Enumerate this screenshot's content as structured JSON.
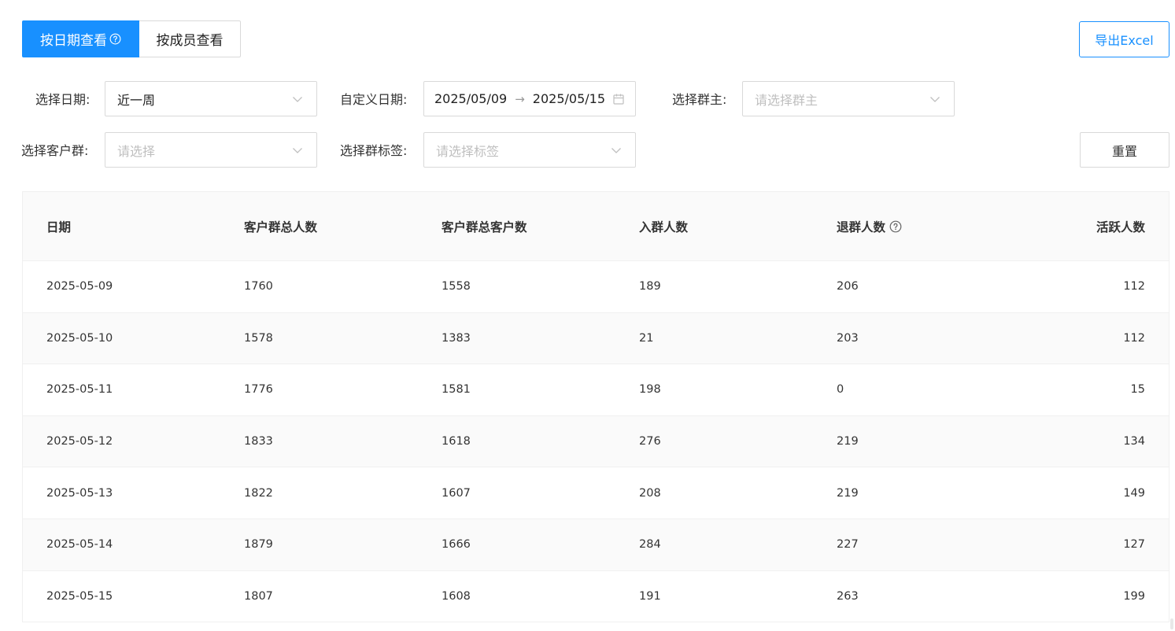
{
  "view_tabs": {
    "by_date": "按日期查看",
    "by_member": "按成员查看"
  },
  "export_label": "导出Excel",
  "filters": {
    "date_label": "选择日期:",
    "date_value": "近一周",
    "custom_label": "自定义日期:",
    "range_start": "2025/05/09",
    "range_end": "2025/05/15",
    "owner_label": "选择群主:",
    "owner_placeholder": "请选择群主",
    "group_label": "选择客户群:",
    "group_placeholder": "请选择",
    "tag_label": "选择群标签:",
    "tag_placeholder": "请选择标签"
  },
  "reset_label": "重置",
  "table": {
    "headers": [
      "日期",
      "客户群总人数",
      "客户群总客户数",
      "入群人数",
      "退群人数",
      "活跃人数"
    ],
    "rows": [
      [
        "2025-05-09",
        "1760",
        "1558",
        "189",
        "206",
        "112"
      ],
      [
        "2025-05-10",
        "1578",
        "1383",
        "21",
        "203",
        "112"
      ],
      [
        "2025-05-11",
        "1776",
        "1581",
        "198",
        "0",
        "15"
      ],
      [
        "2025-05-12",
        "1833",
        "1618",
        "276",
        "219",
        "134"
      ],
      [
        "2025-05-13",
        "1822",
        "1607",
        "208",
        "219",
        "149"
      ],
      [
        "2025-05-14",
        "1879",
        "1666",
        "284",
        "227",
        "127"
      ],
      [
        "2025-05-15",
        "1807",
        "1608",
        "191",
        "263",
        "199"
      ]
    ]
  },
  "colors": {
    "primary": "#1890ff",
    "border": "#d9d9d9",
    "placeholder": "#bfbfbf",
    "table_header_bg": "#fafafa"
  },
  "icons": [
    "question-circle-icon",
    "chevron-down-icon",
    "calendar-icon",
    "arrow-right-icon"
  ]
}
